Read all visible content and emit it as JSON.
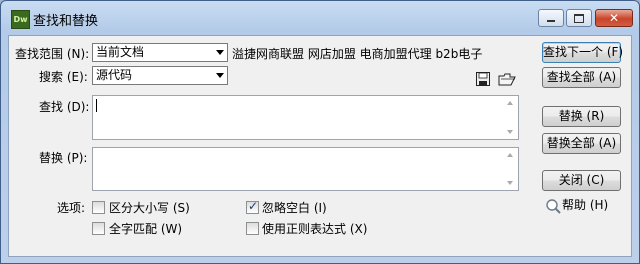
{
  "window": {
    "icon_text": "Dw",
    "title": "查找和替换"
  },
  "search_scope": {
    "label": "查找范围 (N):",
    "value": "当前文档",
    "adjacent_text": "溢捷网商联盟 网店加盟 电商加盟代理 b2b电子"
  },
  "search_type": {
    "label": "搜索 (E):",
    "value": "源代码"
  },
  "find": {
    "label": "查找 (D):",
    "value": ""
  },
  "replace": {
    "label": "替换 (P):",
    "value": ""
  },
  "options": {
    "label": "选项:",
    "match_case": {
      "label": "区分大小写 (S)",
      "checked": false
    },
    "whole_word": {
      "label": "全字匹配 (W)",
      "checked": false
    },
    "ignore_whitespace": {
      "label": "忽略空白 (I)",
      "checked": true
    },
    "use_regex": {
      "label": "使用正则表达式 (X)",
      "checked": false
    }
  },
  "buttons": {
    "find_next": "查找下一个 (F)",
    "find_all": "查找全部 (A)",
    "replace": "替换 (R)",
    "replace_all": "替换全部 (A)",
    "close": "关闭 (C)",
    "help": "帮助 (H)"
  },
  "icons": {
    "save": "save-icon",
    "open": "open-folder-icon"
  }
}
